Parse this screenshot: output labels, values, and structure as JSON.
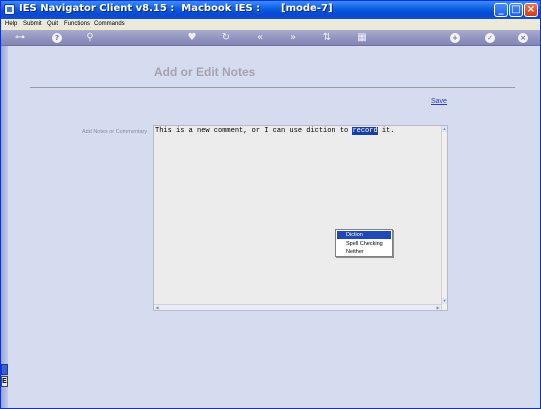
{
  "window": {
    "title": "IES Navigator Client v8.15 :  Macbook IES :      [mode-7]"
  },
  "menu": {
    "items": [
      "Help",
      "Submit",
      "Quit",
      "Functions",
      "Commands"
    ]
  },
  "page": {
    "title": "Add or Edit Notes",
    "save_label": "Save",
    "field_label": "Add Notes or Commentary"
  },
  "notes": {
    "text_before": "This is a new comment, or I can use diction to ",
    "selected_word": "record",
    "text_after": " it."
  },
  "context_menu": {
    "items": [
      "Diction",
      "Spell Checking",
      "Neither"
    ],
    "selected": "Diction"
  },
  "colors": {
    "title_bar": "#0a5de0",
    "toolbar": "#8f92bd",
    "background": "#d6dcf0",
    "highlight": "#2048b8",
    "link": "#2a3ec8"
  }
}
